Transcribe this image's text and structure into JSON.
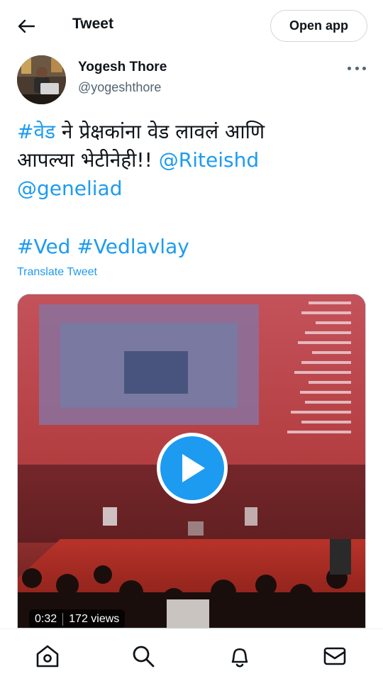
{
  "header": {
    "back_icon": "arrow-left-icon",
    "title": "Tweet",
    "open_app_label": "Open app"
  },
  "tweet": {
    "author_name": "Yogesh Thore",
    "author_handle": "@yogeshthore",
    "more_icon": "more-dots-icon",
    "text_line1_tag": "#वेड",
    "text_line1_rest": " ने प्रेक्षकांना वेड लावलं आणि",
    "text_line2_rest": "आपल्या भेटीनेही!! ",
    "text_line2_mention": "@Riteishd",
    "text_line3_mention": "@geneliad",
    "tag1": "#Ved",
    "tag2": "#Vedlavlay",
    "translate_label": "Translate Tweet"
  },
  "media": {
    "play_icon": "play-icon",
    "duration": "0:32",
    "views": "172 views"
  },
  "bottom_nav": {
    "items": [
      "home-icon",
      "search-icon",
      "notifications-bell-icon",
      "messages-mail-icon"
    ]
  },
  "colors": {
    "accent": "#1d9bf0",
    "text": "#0f1419",
    "secondary": "#536471"
  }
}
